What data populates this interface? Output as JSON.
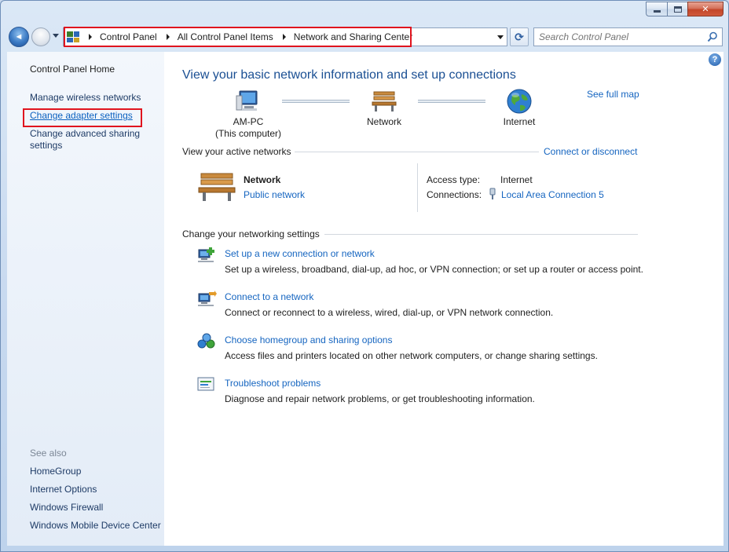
{
  "window": {
    "caption_buttons": [
      "minimize",
      "maximize",
      "close"
    ],
    "close_glyph": "✕"
  },
  "nav": {
    "back_glyph": "◄",
    "breadcrumb": [
      "Control Panel",
      "All Control Panel Items",
      "Network and Sharing Center"
    ],
    "refresh_glyph": "⟳",
    "search_placeholder": "Search Control Panel"
  },
  "sidebar": {
    "home": "Control Panel Home",
    "items": [
      {
        "label": "Manage wireless networks"
      },
      {
        "label": "Change adapter settings"
      },
      {
        "label": "Change advanced sharing settings"
      }
    ],
    "see_also_heading": "See also",
    "see_also": [
      "HomeGroup",
      "Internet Options",
      "Windows Firewall",
      "Windows Mobile Device Center"
    ]
  },
  "main": {
    "help_glyph": "?",
    "title": "View your basic network information and set up connections",
    "see_full_map": "See full map",
    "map": {
      "computer_name": "AM-PC",
      "computer_sub": "(This computer)",
      "network": "Network",
      "internet": "Internet"
    },
    "active": {
      "heading": "View your active networks",
      "connect_link": "Connect or disconnect",
      "network_name": "Network",
      "network_type": "Public network",
      "access_type_label": "Access type:",
      "access_type_value": "Internet",
      "connections_label": "Connections:",
      "connections_value": "Local Area Connection 5"
    },
    "settings": {
      "heading": "Change your networking settings",
      "tasks": [
        {
          "title": "Set up a new connection or network",
          "desc": "Set up a wireless, broadband, dial-up, ad hoc, or VPN connection; or set up a router or access point.",
          "icon": "new-connection-icon"
        },
        {
          "title": "Connect to a network",
          "desc": "Connect or reconnect to a wireless, wired, dial-up, or VPN network connection.",
          "icon": "connect-network-icon"
        },
        {
          "title": "Choose homegroup and sharing options",
          "desc": "Access files and printers located on other network computers, or change sharing settings.",
          "icon": "homegroup-icon"
        },
        {
          "title": "Troubleshoot problems",
          "desc": "Diagnose and repair network problems, or get troubleshooting information.",
          "icon": "troubleshoot-icon"
        }
      ]
    }
  },
  "colors": {
    "link": "#1565c0",
    "highlight_box": "#e0141e",
    "title": "#1a4f93"
  }
}
